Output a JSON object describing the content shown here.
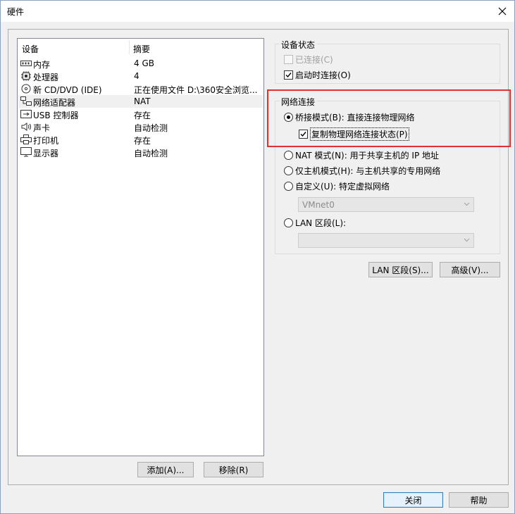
{
  "window": {
    "title": "硬件"
  },
  "device_list": {
    "headers": {
      "device": "设备",
      "summary": "摘要"
    },
    "rows": [
      {
        "icon": "memory-icon",
        "name": "内存",
        "summary": "4 GB"
      },
      {
        "icon": "processor-icon",
        "name": "处理器",
        "summary": "4"
      },
      {
        "icon": "cd-dvd-icon",
        "name": "新 CD/DVD (IDE)",
        "summary": "正在使用文件 D:\\360安全浏览..."
      },
      {
        "icon": "network-adapter-icon",
        "name": "网络适配器",
        "summary": "NAT"
      },
      {
        "icon": "usb-icon",
        "name": "USB 控制器",
        "summary": "存在"
      },
      {
        "icon": "sound-card-icon",
        "name": "声卡",
        "summary": "自动检测"
      },
      {
        "icon": "printer-icon",
        "name": "打印机",
        "summary": "存在"
      },
      {
        "icon": "display-icon",
        "name": "显示器",
        "summary": "自动检测"
      }
    ],
    "add_button": "添加(A)...",
    "remove_button": "移除(R)"
  },
  "device_status": {
    "title": "设备状态",
    "connected": {
      "label": "已连接(C)",
      "checked": false,
      "enabled": false
    },
    "connect_at_power_on": {
      "label": "启动时连接(O)",
      "checked": true
    }
  },
  "network_connection": {
    "title": "网络连接",
    "bridged": {
      "label": "桥接模式(B): 直接连接物理网络",
      "selected": true
    },
    "replicate": {
      "label": "复制物理网络连接状态(P)",
      "checked": true
    },
    "nat": {
      "label": "NAT 模式(N): 用于共享主机的 IP 地址",
      "selected": false
    },
    "host_only": {
      "label": "仅主机模式(H): 与主机共享的专用网络",
      "selected": false
    },
    "custom": {
      "label": "自定义(U): 特定虚拟网络",
      "selected": false
    },
    "custom_combo": "VMnet0",
    "lan_segment": {
      "label": "LAN 区段(L):",
      "selected": false
    },
    "lan_combo": ""
  },
  "buttons": {
    "lan_segments": "LAN 区段(S)...",
    "advanced": "高级(V)...",
    "close": "关闭",
    "help": "帮助"
  },
  "colors": {
    "highlight": "#e03030",
    "accent": "#3c7fb1"
  }
}
